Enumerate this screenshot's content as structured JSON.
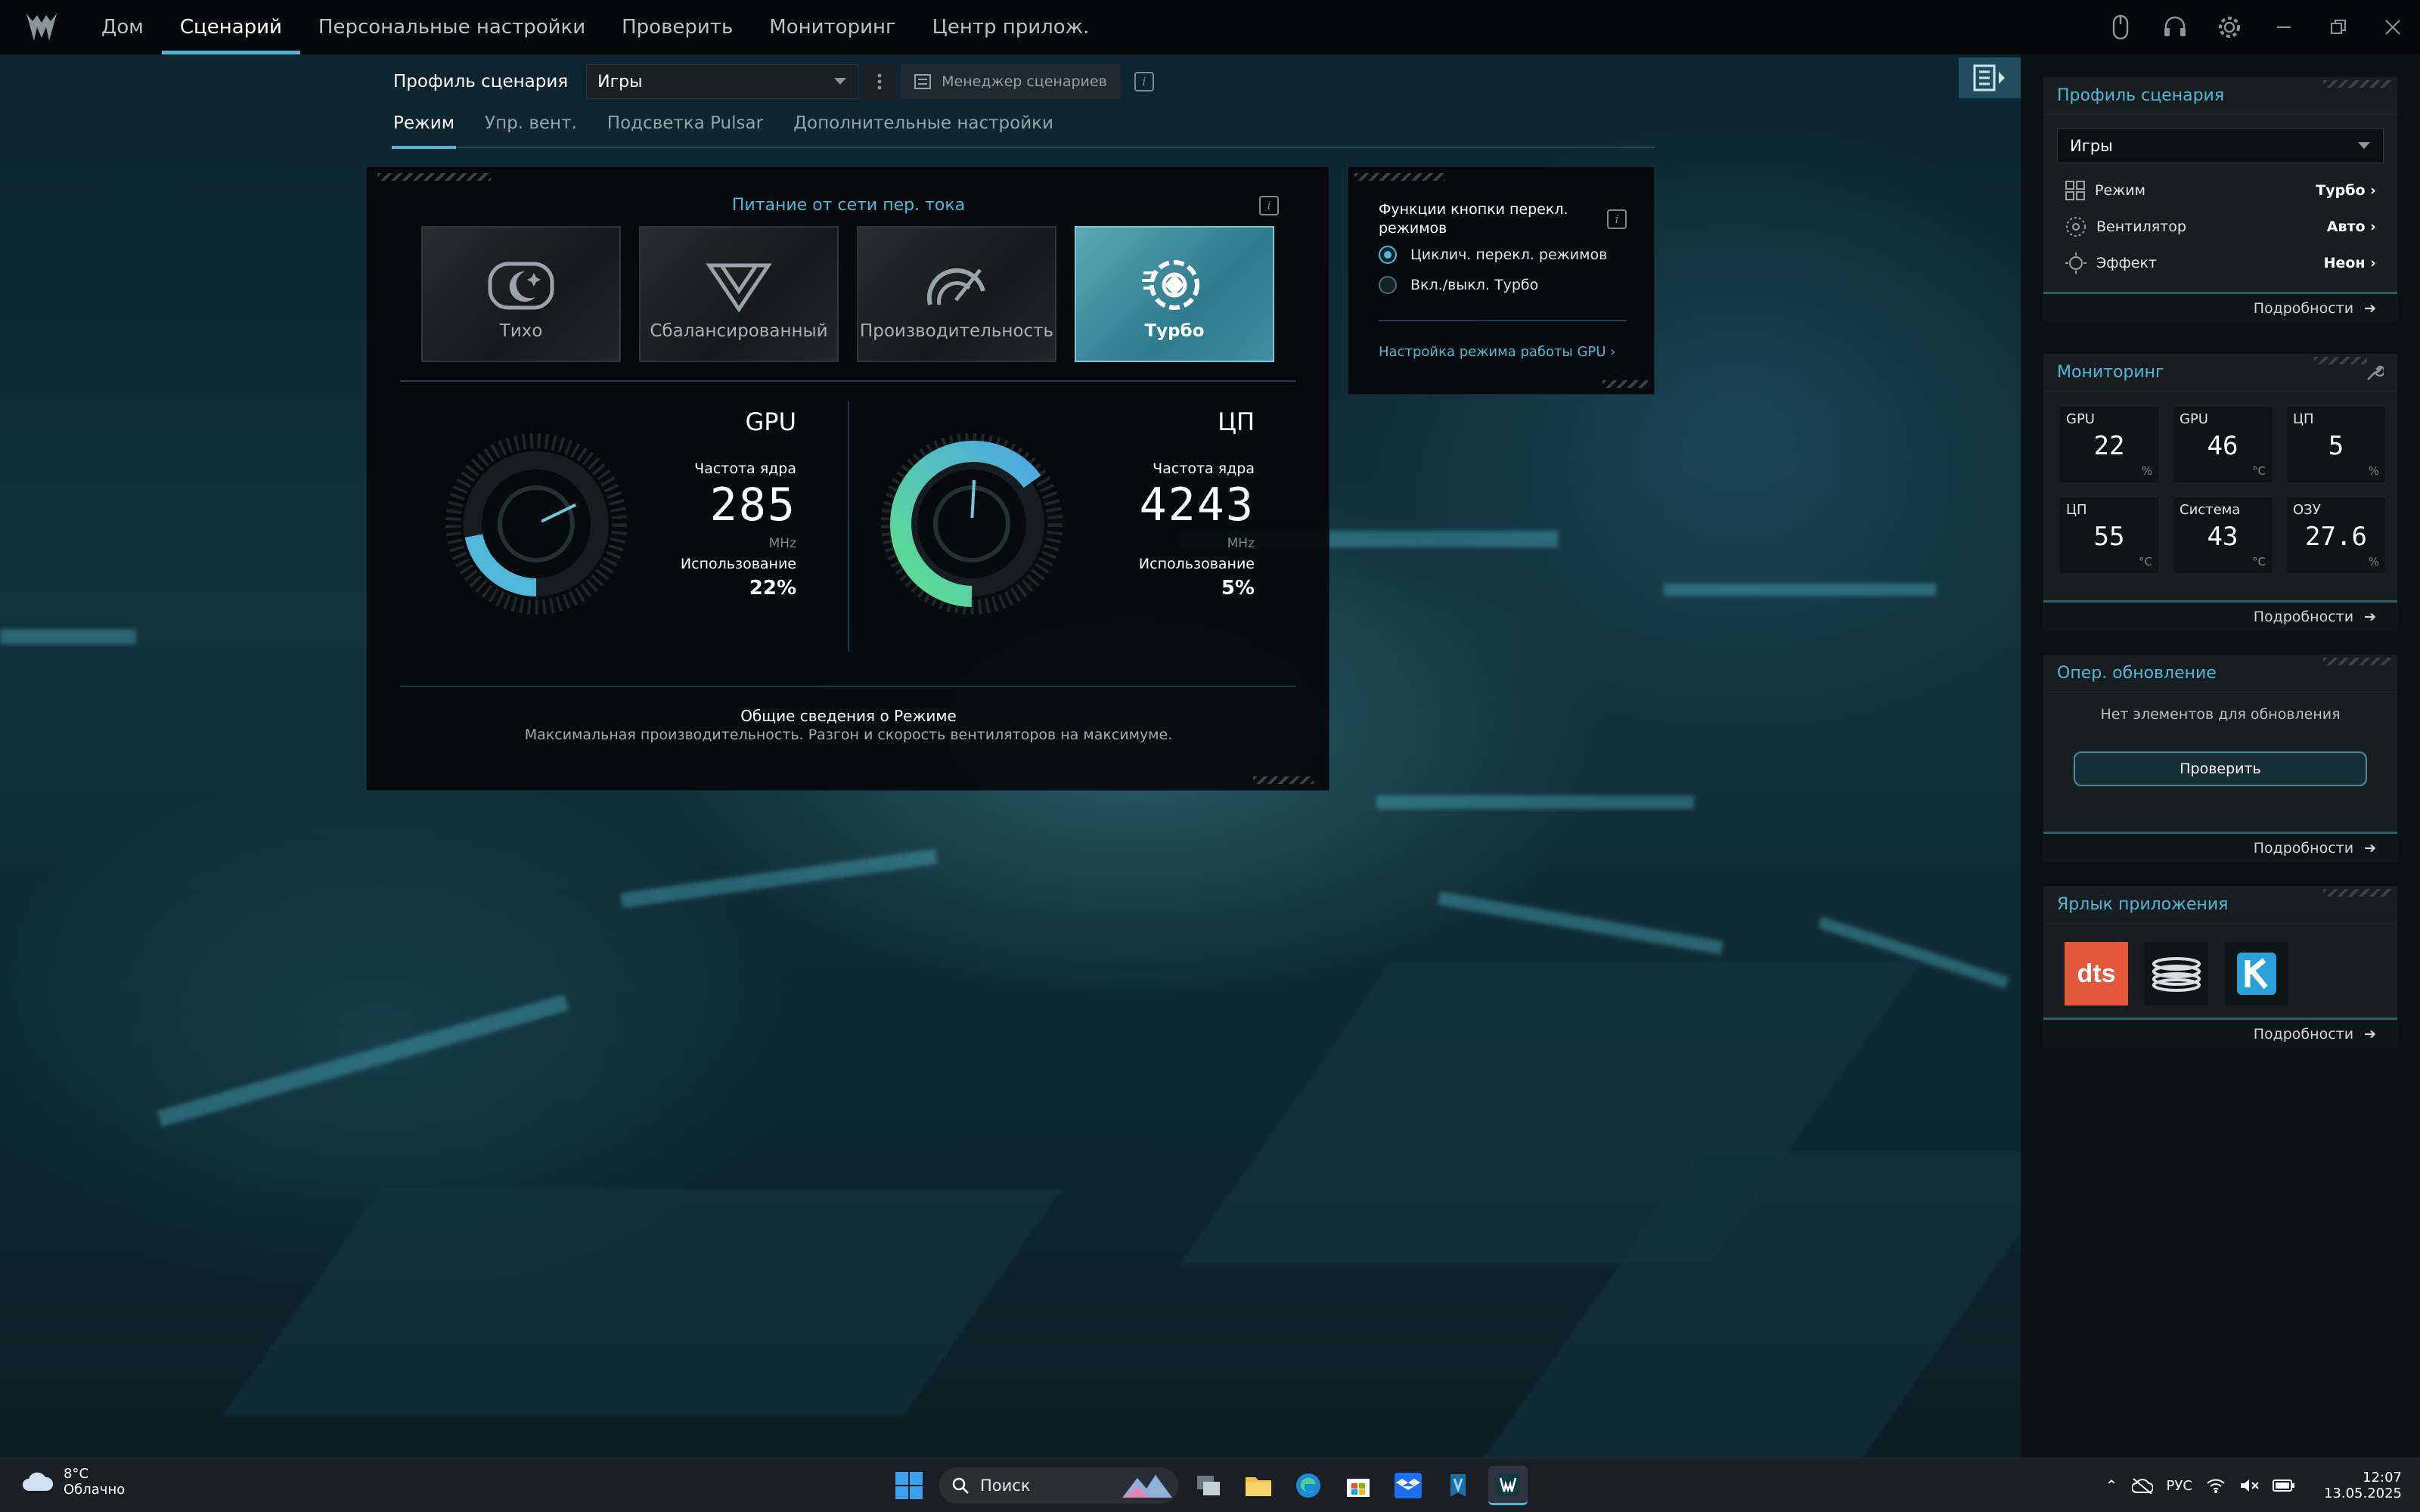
{
  "nav": {
    "items": [
      "Дом",
      "Сценарий",
      "Персональные настройки",
      "Проверить",
      "Мониторинг",
      "Центр прилож."
    ],
    "active_index": 1
  },
  "profile": {
    "label": "Профиль сценария",
    "selected": "Игры",
    "manager_label": "Менеджер сценариев"
  },
  "subtabs": {
    "items": [
      "Режим",
      "Упр. вент.",
      "Подсветка Pulsar",
      "Дополнительные настройки"
    ],
    "active_index": 0
  },
  "mode_panel": {
    "power_label": "Питание от сети пер. тока",
    "modes": [
      "Тихо",
      "Сбалансированный",
      "Производительность",
      "Турбо"
    ],
    "active_mode_index": 3,
    "gpu": {
      "title": "GPU",
      "freq_label": "Частота ядра",
      "freq": "285",
      "unit": "MHz",
      "usage_label": "Использование",
      "usage": "22%",
      "usage_fraction": 0.22
    },
    "cpu": {
      "title": "ЦП",
      "freq_label": "Частота ядра",
      "freq": "4243",
      "unit": "MHz",
      "usage_label": "Использование",
      "usage": "5%",
      "usage_fraction": 0.05
    },
    "summary_title": "Общие сведения о Режиме",
    "summary_desc": "Максимальная производительность. Разгон и скорость вентиляторов на максимуме."
  },
  "button_panel": {
    "title": "Функции кнопки перекл. режимов",
    "options": [
      "Циклич. перекл. режимов",
      "Вкл./выкл. Турбо"
    ],
    "selected_index": 0,
    "gpu_link": "Настройка режима работы GPU"
  },
  "sidebar": {
    "profile_card": {
      "title": "Профиль сценария",
      "selected": "Игры",
      "rows": [
        {
          "label": "Режим",
          "value": "Турбо",
          "icon": "grid-icon"
        },
        {
          "label": "Вентилятор",
          "value": "Авто",
          "icon": "fan-icon"
        },
        {
          "label": "Эффект",
          "value": "Неон",
          "icon": "sun-icon"
        }
      ],
      "more": "Подробности"
    },
    "monitoring_card": {
      "title": "Мониторинг",
      "tiles": [
        {
          "title": "GPU",
          "value": "22",
          "unit": "%"
        },
        {
          "title": "GPU",
          "value": "46",
          "unit": "°C"
        },
        {
          "title": "ЦП",
          "value": "5",
          "unit": "%"
        },
        {
          "title": "ЦП",
          "value": "55",
          "unit": "°C"
        },
        {
          "title": "Система",
          "value": "43",
          "unit": "°C"
        },
        {
          "title": "ОЗУ",
          "value": "27.6",
          "unit": "%"
        }
      ],
      "more": "Подробности"
    },
    "update_card": {
      "title": "Опер. обновление",
      "empty_text": "Нет элементов для обновления",
      "button": "Проверить",
      "more": "Подробности"
    },
    "shortcut_card": {
      "title": "Ярлык приложения",
      "apps": [
        "dts",
        "coil-app",
        "K"
      ],
      "more": "Подробности"
    }
  },
  "taskbar": {
    "temperature": "8°C",
    "condition": "Облачно",
    "search": "Поиск",
    "language": "РУС",
    "time": "12:07",
    "date": "13.05.2025"
  },
  "colors": {
    "accent": "#4fb8d8",
    "turbo_card": "#3f8fa0",
    "dts": "#e4583a"
  }
}
